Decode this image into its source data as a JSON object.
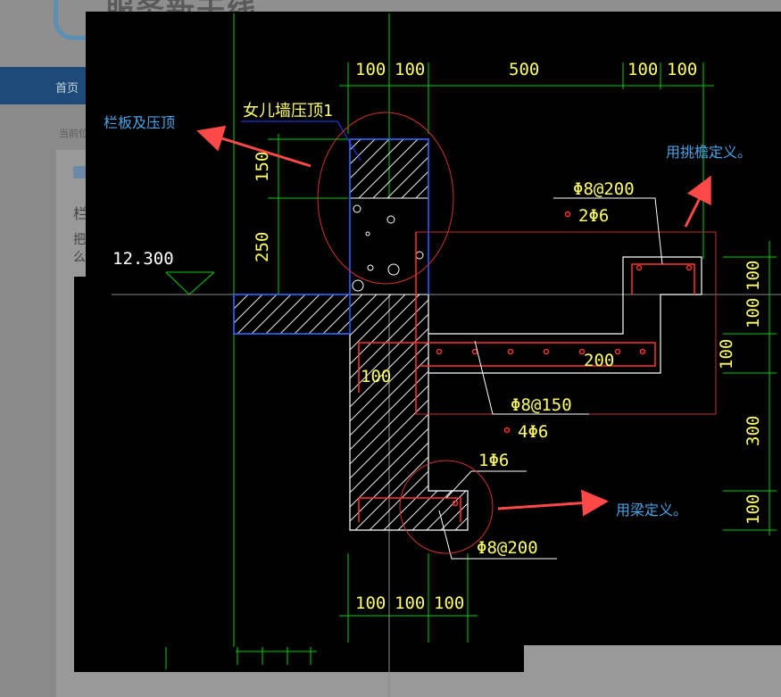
{
  "site": {
    "logo_text": "服务新干线",
    "nav_home": "首页",
    "breadcrumb": "当前位",
    "question_line1": "栏",
    "question_line2": "把",
    "question_line3": "么"
  },
  "drawing": {
    "top_dims": [
      "100",
      "100",
      "500",
      "100",
      "100"
    ],
    "bottom_dims": [
      "100",
      "100",
      "100"
    ],
    "left_dims": [
      "150",
      "250"
    ],
    "right_dims": [
      "100",
      "100",
      "100",
      "300",
      "100"
    ],
    "elevation": "12.300",
    "parapet_label": "女儿墙压顶1",
    "rebar_1": "Φ8@200",
    "rebar_2": "2Φ6",
    "dim_200": "200",
    "dim_100_inner": "100",
    "rebar_3": "Φ8@150",
    "rebar_4": "4Φ6",
    "rebar_5": "1Φ6",
    "rebar_6": "Φ8@200"
  },
  "annotations": {
    "parapet": "栏板及压顶",
    "cornice": "用挑檐定义。",
    "beam": "用梁定义。"
  },
  "colors": {
    "annotation": "#4aa3e6",
    "arrow": "#ff4848",
    "dim_line": "#00d000",
    "text": "#ffff66",
    "rebar": "#ff3030",
    "outline": "#1e5bff"
  }
}
